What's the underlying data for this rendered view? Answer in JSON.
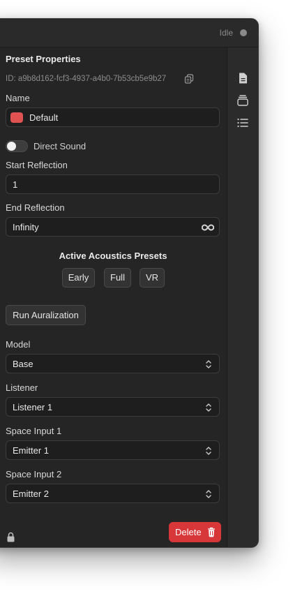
{
  "titlebar": {
    "status": "Idle"
  },
  "inspector": {
    "title": "Preset Properties",
    "id_text": "ID: a9b8d162-fcf3-4937-a4b0-7b53cb5e9b27",
    "name_label": "Name",
    "name_value": "Default",
    "name_color": "#e05252",
    "direct_sound_label": "Direct Sound",
    "direct_sound_on": false,
    "start_reflection_label": "Start Reflection",
    "start_reflection_value": "1",
    "end_reflection_label": "End Reflection",
    "end_reflection_value": "Infinity",
    "active_presets_title": "Active Acoustics Presets",
    "presets": [
      "Early",
      "Full",
      "VR"
    ],
    "run_button": "Run Auralization",
    "model_label": "Model",
    "model_value": "Base",
    "listener_label": "Listener",
    "listener_value": "Listener 1",
    "space_input_1_label": "Space Input 1",
    "space_input_1_value": "Emitter 1",
    "space_input_2_label": "Space Input 2",
    "space_input_2_value": "Emitter 2",
    "delete_button": "Delete"
  },
  "sidebar_icons": [
    "document-icon",
    "stack-icon",
    "list-icon"
  ],
  "colors": {
    "accent_delete": "#d8373a",
    "window_bg": "#252525"
  }
}
